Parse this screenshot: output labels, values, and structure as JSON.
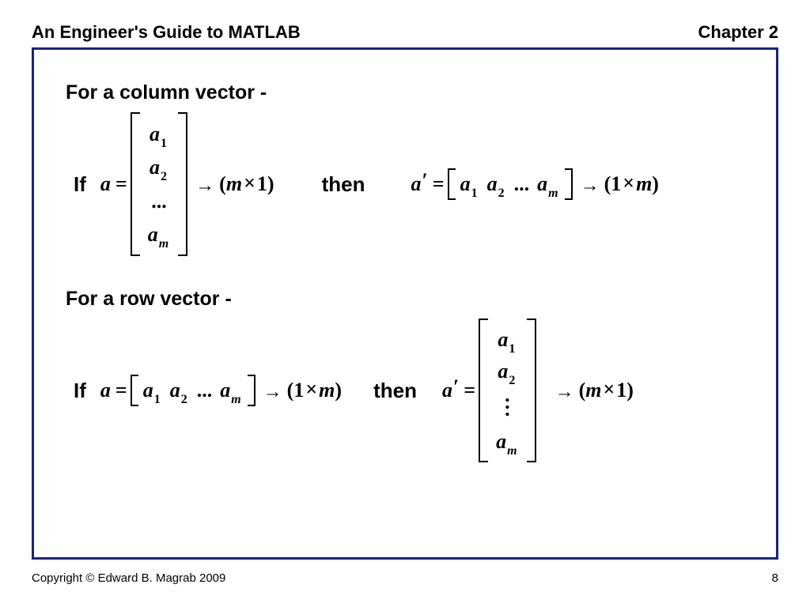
{
  "header": {
    "title": "An Engineer's Guide to MATLAB",
    "chapter": "Chapter 2"
  },
  "footer": {
    "copyright": "Copyright © Edward B. Magrab 2009",
    "page_num": "8"
  },
  "sections": {
    "col": {
      "title": "For a column vector -",
      "if": "If",
      "then": "then",
      "var": "a",
      "var_t": "a",
      "entries": [
        "a",
        "a",
        "...",
        "a"
      ],
      "subs": [
        "1",
        "2",
        "",
        "m"
      ],
      "row_entries": [
        "a",
        "a",
        "...",
        "a"
      ],
      "row_subs": [
        "1",
        "2",
        "",
        "m"
      ],
      "size_lhs": {
        "open": "(",
        "a": "m",
        "op": "×",
        "b": "1",
        "close": ")"
      },
      "size_rhs": {
        "open": "(",
        "a": "1",
        "op": "×",
        "b": "m",
        "close": ")"
      },
      "arrow": "→",
      "eq": "=",
      "prime": "′"
    },
    "row": {
      "title": "For a row vector -",
      "if": "If",
      "then": "then",
      "var": "a",
      "var_t": "a",
      "entries": [
        "a",
        "a",
        "...",
        "a"
      ],
      "subs": [
        "1",
        "2",
        "",
        "m"
      ],
      "col_entries": [
        "a",
        "a",
        "",
        "a"
      ],
      "col_subs": [
        "1",
        "2",
        "",
        "m"
      ],
      "size_lhs": {
        "open": "(",
        "a": "1",
        "op": "×",
        "b": "m",
        "close": ")"
      },
      "size_rhs": {
        "open": "(",
        "a": "m",
        "op": "×",
        "b": "1",
        "close": ")"
      },
      "arrow": "→",
      "eq": "=",
      "prime": "′"
    }
  }
}
